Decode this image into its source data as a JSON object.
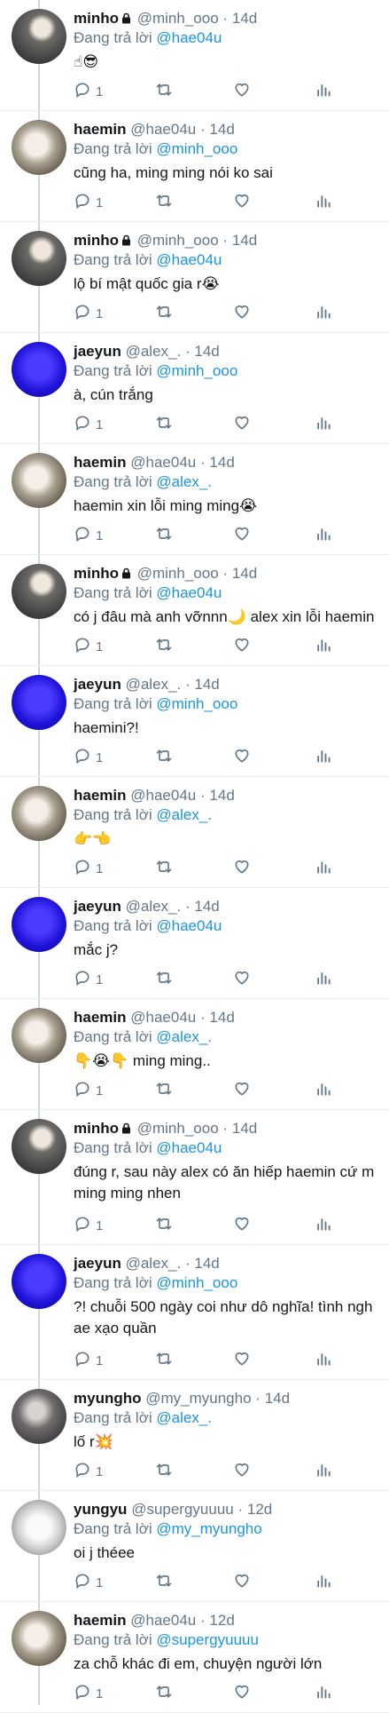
{
  "reply_prefix": "Đang trả lời",
  "dot": "·",
  "tweets": [
    {
      "name": "minho",
      "locked": true,
      "handle": "@minh_ooo",
      "time": "14d",
      "reply_to": "@hae04u",
      "text": "☝😎",
      "replies": "1"
    },
    {
      "name": "haemin",
      "locked": false,
      "handle": "@hae04u",
      "time": "14d",
      "reply_to": "@minh_ooo",
      "text": "cũng ha, ming ming nói ko sai",
      "replies": "1"
    },
    {
      "name": "minho",
      "locked": true,
      "handle": "@minh_ooo",
      "time": "14d",
      "reply_to": "@hae04u",
      "text": "lộ bí mật quốc gia r😭",
      "replies": "1"
    },
    {
      "name": "jaeyun",
      "locked": false,
      "handle": "@alex_.",
      "time": "14d",
      "reply_to": "@minh_ooo",
      "text": "à, cún trắng",
      "replies": "1"
    },
    {
      "name": "haemin",
      "locked": false,
      "handle": "@hae04u",
      "time": "14d",
      "reply_to": "@alex_.",
      "text": "haemin xin lỗi ming ming😭",
      "replies": "1"
    },
    {
      "name": "minho",
      "locked": true,
      "handle": "@minh_ooo",
      "time": "14d",
      "reply_to": "@hae04u",
      "text": "có j đâu mà anh vỡnnn🌙 alex xin lỗi haemin",
      "replies": "1"
    },
    {
      "name": "jaeyun",
      "locked": false,
      "handle": "@alex_.",
      "time": "14d",
      "reply_to": "@minh_ooo",
      "text": "haemini?!",
      "replies": "1"
    },
    {
      "name": "haemin",
      "locked": false,
      "handle": "@hae04u",
      "time": "14d",
      "reply_to": "@alex_.",
      "text": "👉👈",
      "replies": "1"
    },
    {
      "name": "jaeyun",
      "locked": false,
      "handle": "@alex_.",
      "time": "14d",
      "reply_to": "@hae04u",
      "text": "mắc j?",
      "replies": "1"
    },
    {
      "name": "haemin",
      "locked": false,
      "handle": "@hae04u",
      "time": "14d",
      "reply_to": "@alex_.",
      "text": "👇😭👇 ming ming..",
      "replies": "1"
    },
    {
      "name": "minho",
      "locked": true,
      "handle": "@minh_ooo",
      "time": "14d",
      "reply_to": "@hae04u",
      "text": "đúng r, sau này alex có ăn hiếp haemin cứ m\nming ming nhen",
      "replies": "1"
    },
    {
      "name": "jaeyun",
      "locked": false,
      "handle": "@alex_.",
      "time": "14d",
      "reply_to": "@minh_ooo",
      "text": "?! chuỗi 500 ngày coi như dô nghĩa! tình ngh\nae xạo quần",
      "replies": "1"
    },
    {
      "name": "myungho",
      "locked": false,
      "handle": "@my_myungho",
      "time": "14d",
      "reply_to": "@alex_.",
      "text": "lố r💥",
      "replies": "1"
    },
    {
      "name": "yungyu",
      "locked": false,
      "handle": "@supergyuuuu",
      "time": "12d",
      "reply_to": "@my_myungho",
      "text": "oi j théee",
      "replies": "1"
    },
    {
      "name": "haemin",
      "locked": false,
      "handle": "@hae04u",
      "time": "12d",
      "reply_to": "@supergyuuuu",
      "text": "za chỗ khác đi em, chuyện người lớn",
      "replies": "1"
    }
  ],
  "icons": {
    "reply": "reply-icon",
    "retweet": "retweet-icon",
    "like": "heart-icon",
    "stats": "analytics-icon",
    "lock": "lock-icon"
  }
}
